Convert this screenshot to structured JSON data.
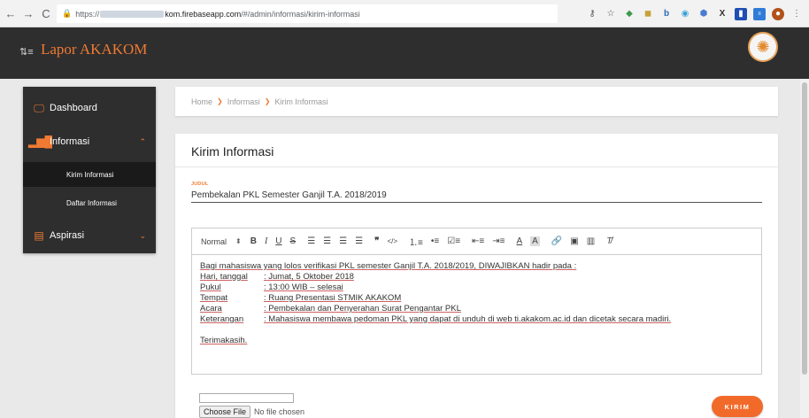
{
  "browser": {
    "back": "←",
    "forward": "→",
    "reload": "C",
    "url_prefix": "https://",
    "url_host_visible": "kom.firebaseapp.com",
    "url_path": "/#/admin/informasi/kirim-informasi",
    "extension_icons": [
      "key-icon",
      "star-icon",
      "drive-icon",
      "kaspersky-icon",
      "bookmark-icon",
      "tab-icon",
      "shield-icon",
      "x-icon",
      "ext-blue-icon",
      "new-icon",
      "profile-icon",
      "menu-icon"
    ]
  },
  "app": {
    "title": "Lapor AKAKOM",
    "accent_color": "#f07a33",
    "header_color": "#2e2e2e"
  },
  "sidebar": {
    "items": [
      {
        "label": "Dashboard",
        "icon": "monitor-icon"
      },
      {
        "label": "Informasi",
        "icon": "bar-chart-icon",
        "expanded": true,
        "children": [
          {
            "label": "Kirim Informasi",
            "active": true
          },
          {
            "label": "Daftar Informasi"
          }
        ]
      },
      {
        "label": "Aspirasi",
        "icon": "document-icon"
      }
    ]
  },
  "breadcrumb": [
    "Home",
    "Informasi",
    "Kirim Informasi"
  ],
  "form": {
    "card_title": "Kirim Informasi",
    "judul_label": "JUDUL",
    "judul_value": "Pembekalan PKL Semester Ganjil T.A. 2018/2019",
    "editor_format": "Normal",
    "body": {
      "intro": "Bagi mahasiswa yang lolos verifikasi PKL semester Ganjil T.A. 2018/2019, DIWAJIBKAN hadir pada :",
      "rows": [
        {
          "key": "Hari, tanggal",
          "value": ": Jumat, 5 Oktober 2018"
        },
        {
          "key": "Pukul",
          "value": ": 13:00 WIB – selesai"
        },
        {
          "key": "Tempat",
          "value": ": Ruang Presentasi STMIK AKAKOM"
        },
        {
          "key": "Acara",
          "value": ": Pembekalan dan Penyerahan Surat Pengantar PKL"
        },
        {
          "key": "Keterangan",
          "value": ": Mahasiswa membawa pedoman PKL yang dapat di unduh  di web ti.akakom.ac.id dan dicetak secara madiri."
        }
      ],
      "closing": "Terimakasih."
    },
    "file_button": "Choose File",
    "file_status": "No file chosen",
    "submit_label": "KIRIM"
  }
}
